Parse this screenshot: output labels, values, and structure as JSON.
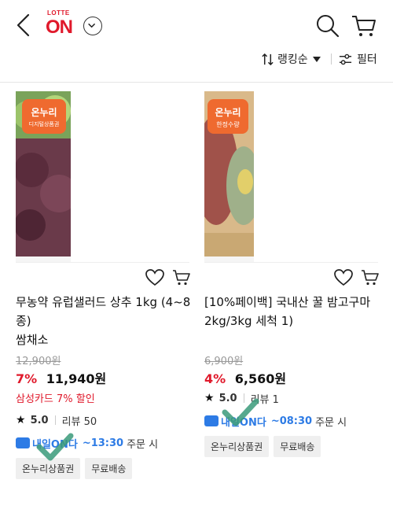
{
  "header": {
    "logo_top": "LOTTE",
    "logo_main": "ON"
  },
  "toolbar": {
    "sort_label": "랭킹순",
    "filter_label": "필터"
  },
  "products": [
    {
      "badge_main": "온누리",
      "badge_sub": "디지털상품권",
      "title": "무농약 유럽샐러드 상추 1kg (4~8종)",
      "seller": "쌈채소",
      "original_price": "12,900원",
      "discount": "7%",
      "price": "11,940원",
      "card_discount": "삼성카드 7% 할인",
      "rating": "5.0",
      "review": "리뷰 50",
      "delivery_badge": "내일ON다",
      "delivery_time": "~13:30",
      "delivery_order": "주문 시",
      "tags": [
        "온누리상품권",
        "무료배송"
      ]
    },
    {
      "badge_main": "온누리",
      "badge_sub": "한정수량",
      "title": "[10%페이백] 국내산 꿀 밤고구마 2kg/3kg 세척 1)",
      "seller": "",
      "original_price": "6,900원",
      "discount": "4%",
      "price": "6,560원",
      "card_discount": "",
      "rating": "5.0",
      "review": "리뷰 1",
      "delivery_badge": "내일ON다",
      "delivery_time": "~08:30",
      "delivery_order": "주문 시",
      "tags": [
        "온누리상품권",
        "무료배송"
      ]
    }
  ],
  "colors": {
    "brand_red": "#e0192b",
    "onnuri_orange": "#ef6a2f",
    "delivery_blue": "#2d7be5",
    "check_green": "#3a9a7a"
  }
}
